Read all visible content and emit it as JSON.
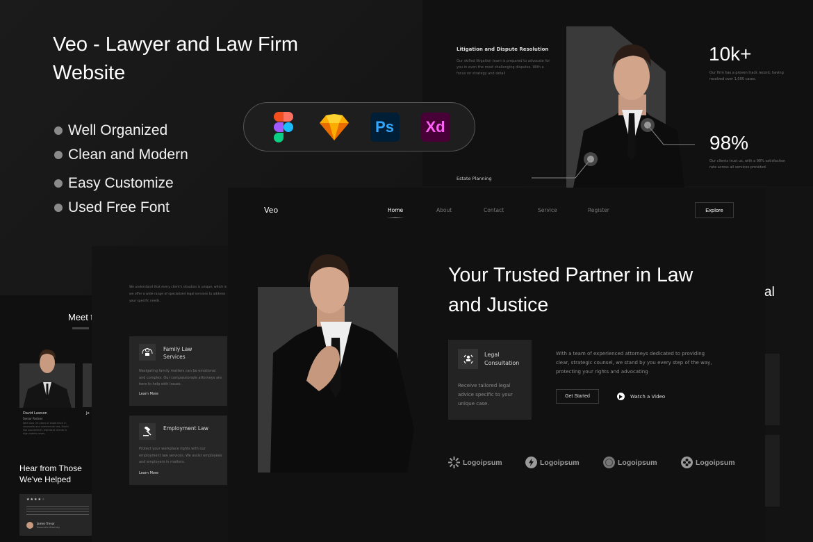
{
  "hero": {
    "title": "Veo - Lawyer and Law Firm Website",
    "features": [
      "Well Organized",
      "Clean and Modern",
      "Easy Customize",
      "Used Free Font"
    ]
  },
  "tools": [
    {
      "name": "Figma",
      "icon": "figma-icon"
    },
    {
      "name": "Sketch",
      "icon": "sketch-icon"
    },
    {
      "name": "Ps",
      "icon": "photoshop-icon"
    },
    {
      "name": "Xd",
      "icon": "adobe-xd-icon"
    }
  ],
  "about_preview": {
    "service_title": "Litigation and Dispute Resolution",
    "service_desc": "Our skilled litigation team is prepared to advocate for you in even the most challenging disputes. With a focus on strategy and detail",
    "estate_label": "Estate Planning",
    "stats": [
      {
        "value": "10k+",
        "desc": "Our firm has a proven track record, having resolved over 1,000 cases."
      },
      {
        "value": "98%",
        "desc": "Our clients trust us, with a 98% satisfaction rate across all services provided."
      }
    ]
  },
  "main": {
    "logo": "Veo",
    "nav": [
      "Home",
      "About",
      "Contact",
      "Service",
      "Register"
    ],
    "active_nav": "Home",
    "explore_label": "Explore",
    "headline": "Your Trusted Partner in Law and Justice",
    "consult": {
      "title": "Legal Consultation",
      "desc": "Receive tailored legal advice specific to your unique case."
    },
    "intro": "With a team of experienced attorneys dedicated to providing clear, strategic counsel, we stand by you every step of the way, protecting your rights and advocating",
    "get_started_label": "Get Started",
    "watch_label": "Watch a Video",
    "logos": [
      "Logoipsum",
      "Logoipsum",
      "Logoipsum",
      "Logoipsum"
    ],
    "side_fragment": "al"
  },
  "services_preview": {
    "intro": "We understand that every client's situation is unique, which is we offer a wide range of specialized legal services to address your specific needs.",
    "cards": [
      {
        "title": "Family Law Services",
        "desc": "Navigating family matters can be emotional and complex. Our compassionate attorneys are here to help with issues.",
        "link": "Learn More"
      },
      {
        "title": "Employment Law",
        "desc": "Protect your workplace rights with our employment law services. We assist employees and employers in matters.",
        "link": "Learn More"
      }
    ]
  },
  "team_preview": {
    "heading_fragment": "Meet t",
    "member_name": "David Lawson",
    "member_role": "Senior Partner",
    "member_desc": "With over 20 years of experience in corporate and commercial law, David has successfully represent clients in high-stakes cases.",
    "second_name_fragment": "Je",
    "testimonial_heading": "Hear from Those We've Helped",
    "rating": 4,
    "rating_max": 5,
    "reviewer_name": "James Trevor",
    "reviewer_role": "Associate Attorney"
  }
}
